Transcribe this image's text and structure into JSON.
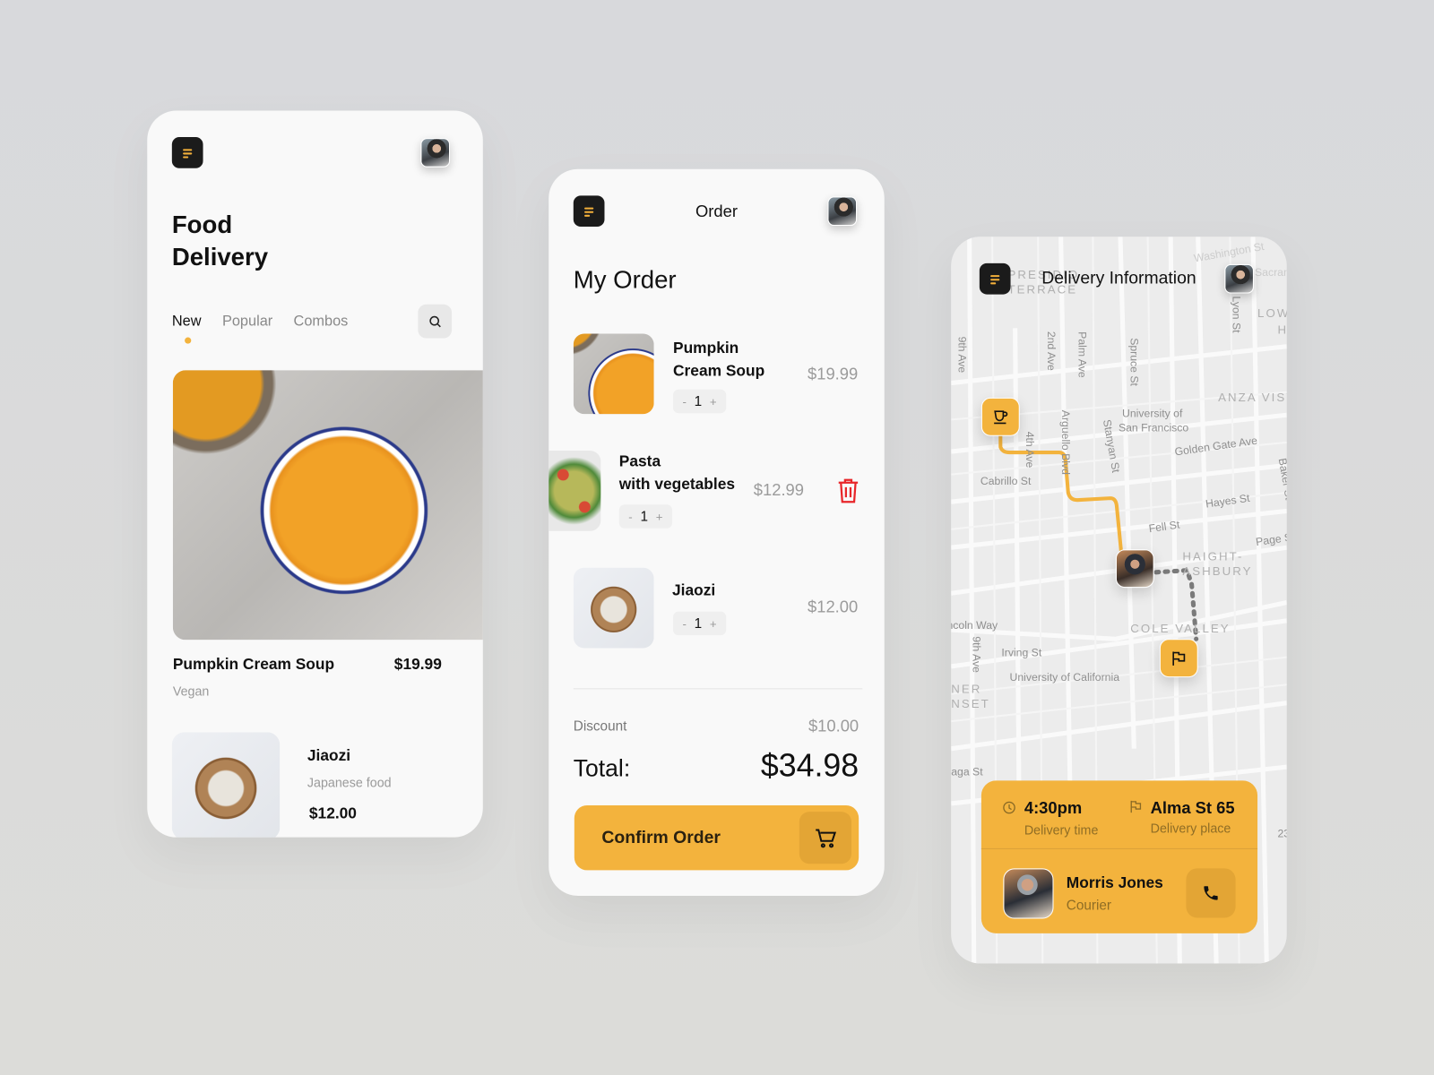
{
  "colors": {
    "accent": "#f3b33d",
    "dark": "#1b1b1b",
    "delete": "#e8262a"
  },
  "menu": {
    "dashboard": {
      "title": "Food\nDelivery",
      "title_line1": "Food",
      "title_line2": "Delivery",
      "tabs": [
        {
          "label": "New",
          "active": true
        },
        {
          "label": "Popular"
        },
        {
          "label": "Combos"
        }
      ],
      "search_icon": "search-icon",
      "featured": {
        "name": "Pumpkin Cream Soup",
        "price": "$19.99",
        "tag": "Vegan"
      },
      "list": [
        {
          "name": "Jiaozi",
          "category": "Japanese food",
          "price": "$12.00"
        }
      ]
    }
  },
  "order": {
    "header": "Order",
    "title": "My Order",
    "items": [
      {
        "name_line1": "Pumpkin",
        "name_line2": "Cream Soup",
        "qty": "1",
        "price": "$19.99",
        "minus": "-",
        "plus": "+"
      },
      {
        "name_line1": "Pasta",
        "name_line2": "with vegetables",
        "qty": "1",
        "price": "$12.99",
        "minus": "-",
        "plus": "+"
      },
      {
        "name_line1": "Jiaozi",
        "qty": "1",
        "price": "$12.00",
        "minus": "-",
        "plus": "+"
      }
    ],
    "discount_label": "Discount",
    "discount": "$10.00",
    "total_label": "Total:",
    "total": "$34.98",
    "confirm_label": "Confirm Order"
  },
  "delivery": {
    "title": "Delivery Information",
    "map": {
      "labels": [
        "PRESIDIO",
        "TERRACE",
        "Washington St",
        "Sacramento",
        "LOW",
        "H",
        "Lyon St",
        "9th Ave",
        "2nd Ave",
        "Palm Ave",
        "Spruce St",
        "ANZA VISTA",
        "University of",
        "San Francisco",
        "Golden Gate Ave",
        "Arguello Blvd",
        "Stanyan St",
        "4th Ave",
        "Cabrillo St",
        "Baker St",
        "Hayes St",
        "Fell St",
        "Page St",
        "HAIGHT-",
        "ASHBURY",
        "COLE VALLEY",
        "Lincoln Way",
        "9th Ave",
        "Irving St",
        "University of California",
        "NER",
        "NSET",
        "aga St",
        "23"
      ]
    },
    "time": "4:30pm",
    "time_label": "Delivery time",
    "place": "Alma St 65",
    "place_label": "Delivery place",
    "courier": {
      "name": "Morris Jones",
      "role": "Courier"
    }
  }
}
